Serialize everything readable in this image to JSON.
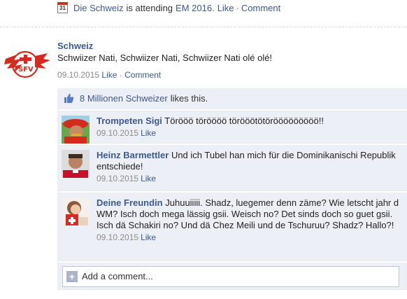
{
  "activity": {
    "calendar_day": "31",
    "page_name": "Die Schweiz",
    "is_attending": "is attending",
    "event_name": "EM 2016.",
    "like_label": "Like",
    "separator": "·",
    "comment_label": "Comment"
  },
  "post": {
    "author": "Schweiz",
    "text": "Schwiizer Nati, Schwiizer Nati, Schwiizer Nati olé olé!",
    "date": "09.10.2015",
    "like_label": "Like",
    "separator": "·",
    "comment_label": "Comment",
    "avatar_icon": "swiss-football-logo-icon"
  },
  "likes": {
    "count_text": "8 Millionen Schweizer",
    "suffix": "likes this.",
    "icon": "thumbs-up-icon"
  },
  "comments": [
    {
      "author": "Trompeten Sigi",
      "text": "Törööö töröööö törööötötörööööööööö!!",
      "date": "09.10.2015",
      "like_label": "Like"
    },
    {
      "author": "Heinz Barmettler",
      "text": "Und ich Tubel han mich für die Dominikanischi Republik entschiede!",
      "date": "09.10.2015",
      "like_label": "Like"
    },
    {
      "author": "Deine Freundin",
      "text": "Juhuuiiiii. Shadz, luegemer denn zäme? Wie letscht jahr d WM? Isch doch mega lässig gsii. Weisch no? Det sinds doch so guet gsii. Isch dä Schakiri no? Und dä Chez Meili und de Tschuruu? Shadz? Hallo?!",
      "date": "09.10.2015",
      "like_label": "Like"
    }
  ],
  "add_comment": {
    "placeholder": "Add a comment...",
    "icon": "plus-icon"
  },
  "colors": {
    "link": "#3b5998",
    "meta": "#8c8c8c",
    "ufi_bg": "#eceff5",
    "swiss_red": "#d52b1e"
  }
}
